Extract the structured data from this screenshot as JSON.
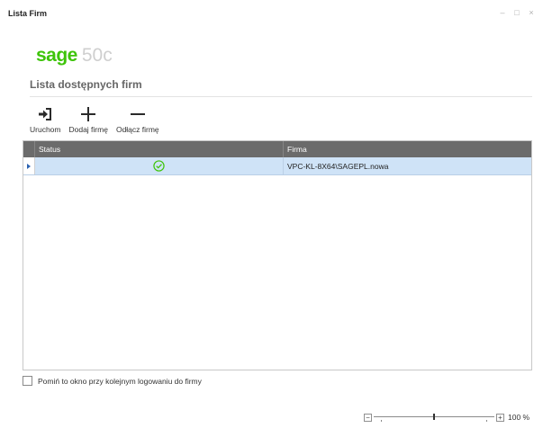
{
  "window": {
    "title": "Lista Firm",
    "controls": {
      "minimize": "–",
      "maximize": "□",
      "close": "×"
    }
  },
  "logo": {
    "brand": "sage",
    "version": "50c",
    "brand_color": "#3ec40a",
    "version_color": "#cfcfcf"
  },
  "section_title": "Lista dostępnych firm",
  "toolbar": {
    "items": [
      {
        "label": "Uruchom",
        "icon": "login-arrow-icon"
      },
      {
        "label": "Dodaj firmę",
        "icon": "plus-icon"
      },
      {
        "label": "Odłącz firmę",
        "icon": "minus-icon"
      }
    ]
  },
  "grid": {
    "columns": [
      "Status",
      "Firma"
    ],
    "header_color": "#6b6b6b",
    "selected_row_color": "#cfe3f7",
    "rows": [
      {
        "status_icon": "check-circle-icon",
        "status_color": "#3ec40a",
        "firma": "VPC-KL-8X64\\SAGEPL.nowa"
      }
    ]
  },
  "checkbox": {
    "label": "Pomiń to okno przy kolejnym logowaniu do firmy",
    "checked": false
  },
  "zoom": {
    "minus": "−",
    "plus": "+",
    "value": "100 %",
    "level_fraction": 0.5
  }
}
